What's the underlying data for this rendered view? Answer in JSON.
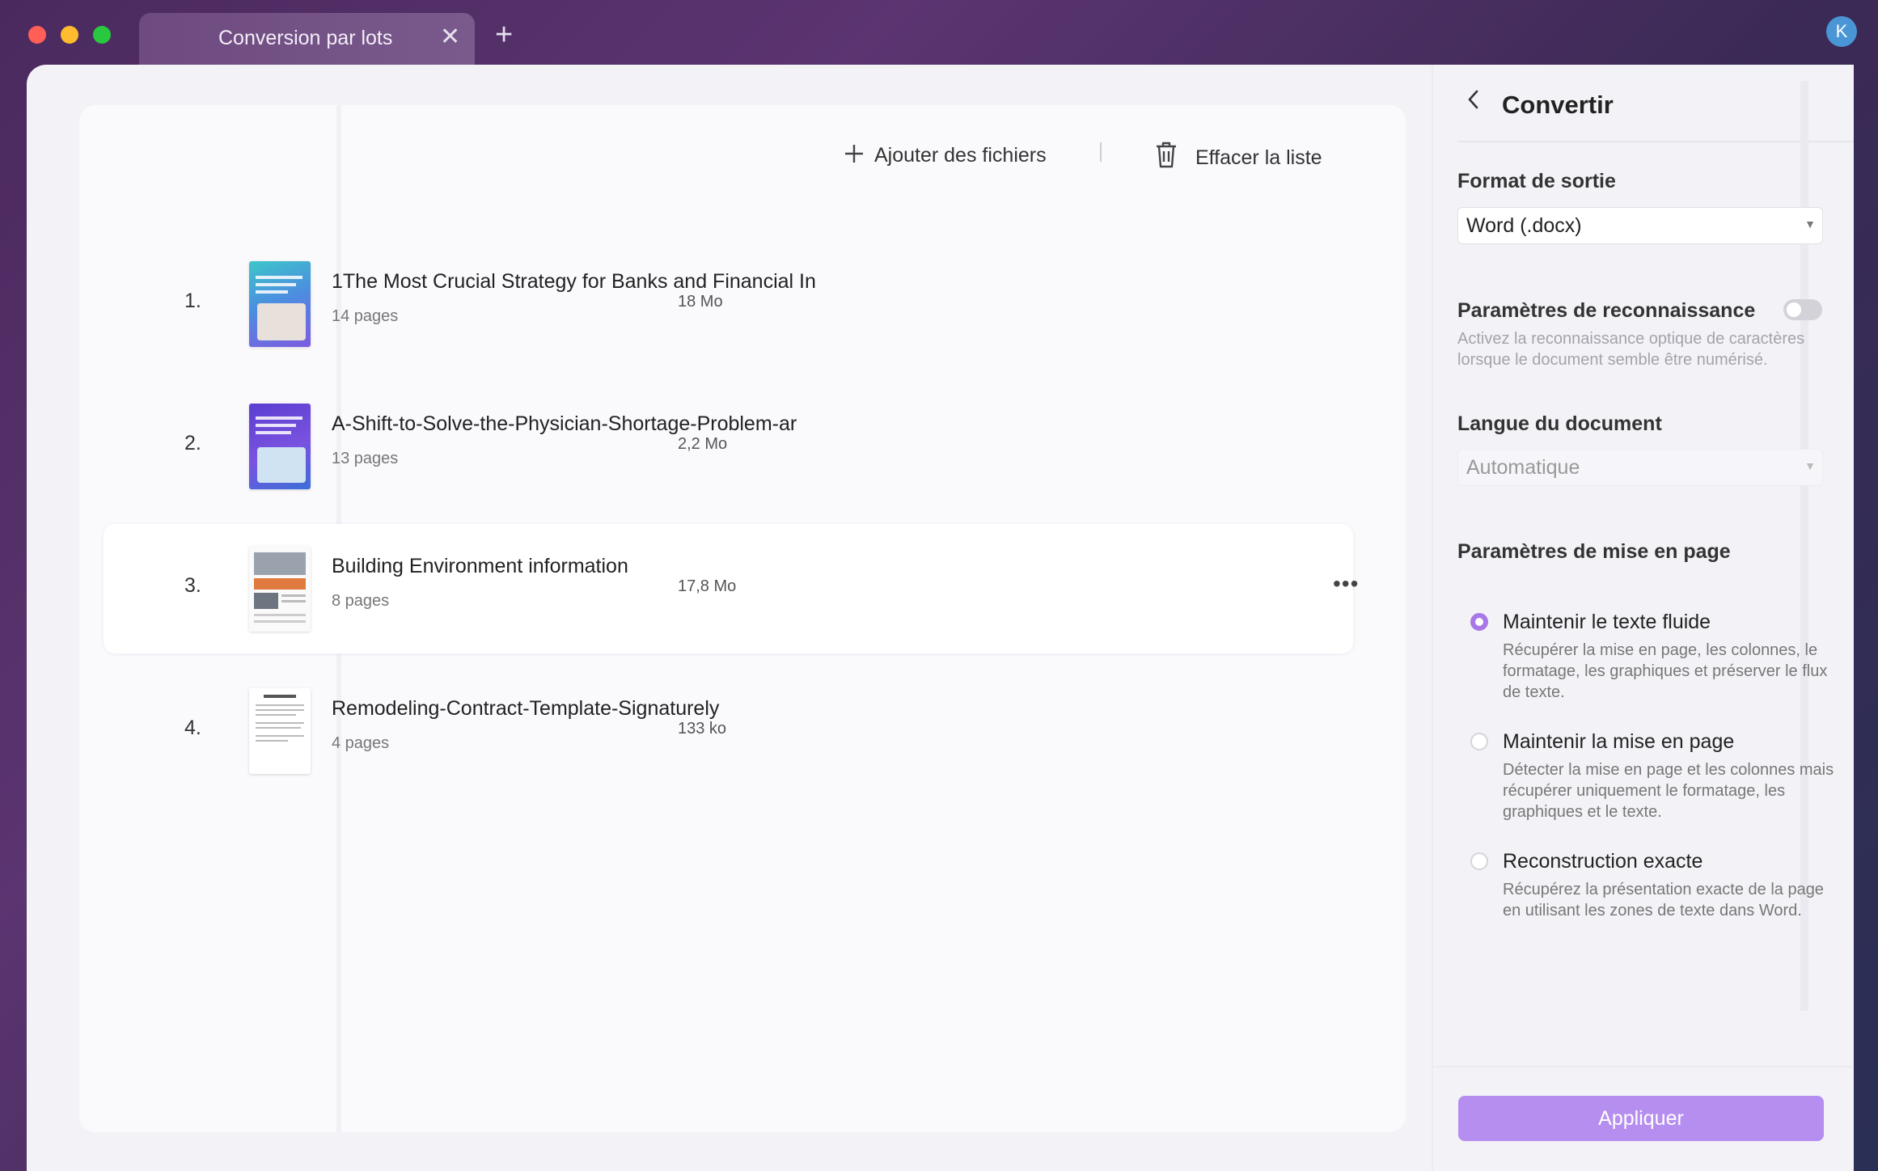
{
  "tab": {
    "title": "Conversion par lots",
    "close_glyph": "✕",
    "add_glyph": "+"
  },
  "avatar": {
    "initial": "K"
  },
  "toolbar": {
    "add_label": "Ajouter des fichiers",
    "clear_label": "Effacer la liste"
  },
  "files": [
    {
      "num": "1.",
      "title": "1The Most Crucial Strategy for Banks and Financial In",
      "pages": "14 pages",
      "size": "18 Mo"
    },
    {
      "num": "2.",
      "title": "A-Shift-to-Solve-the-Physician-Shortage-Problem-ar",
      "pages": "13 pages",
      "size": "2,2 Mo"
    },
    {
      "num": "3.",
      "title": "Building Environment information",
      "pages": "8 pages",
      "size": "17,8 Mo"
    },
    {
      "num": "4.",
      "title": "Remodeling-Contract-Template-Signaturely",
      "pages": "4 pages",
      "size": "133 ko"
    }
  ],
  "panel": {
    "title": "Convertir",
    "output_format_label": "Format de sortie",
    "output_format_value": "Word (.docx)",
    "ocr_label": "Paramètres de reconnaissance",
    "ocr_help": "Activez la reconnaissance optique de caractères lorsque le document semble être numérisé.",
    "ocr_enabled": false,
    "language_label": "Langue du document",
    "language_value": "Automatique",
    "layout_label": "Paramètres de mise en page",
    "layout_options": [
      {
        "label": "Maintenir le texte fluide",
        "desc": "Récupérer la mise en page, les colonnes, le formatage, les graphiques et préserver le flux de texte.",
        "selected": true
      },
      {
        "label": "Maintenir la mise en page",
        "desc": "Détecter la mise en page et les colonnes mais récupérer uniquement le formatage, les graphiques et le texte.",
        "selected": false
      },
      {
        "label": "Reconstruction exacte",
        "desc": "Récupérez la présentation exacte de la page en utilisant les zones de texte dans Word.",
        "selected": false
      }
    ],
    "apply_label": "Appliquer"
  },
  "colors": {
    "accent": "#a877e8",
    "apply_button": "#b68ef0"
  }
}
